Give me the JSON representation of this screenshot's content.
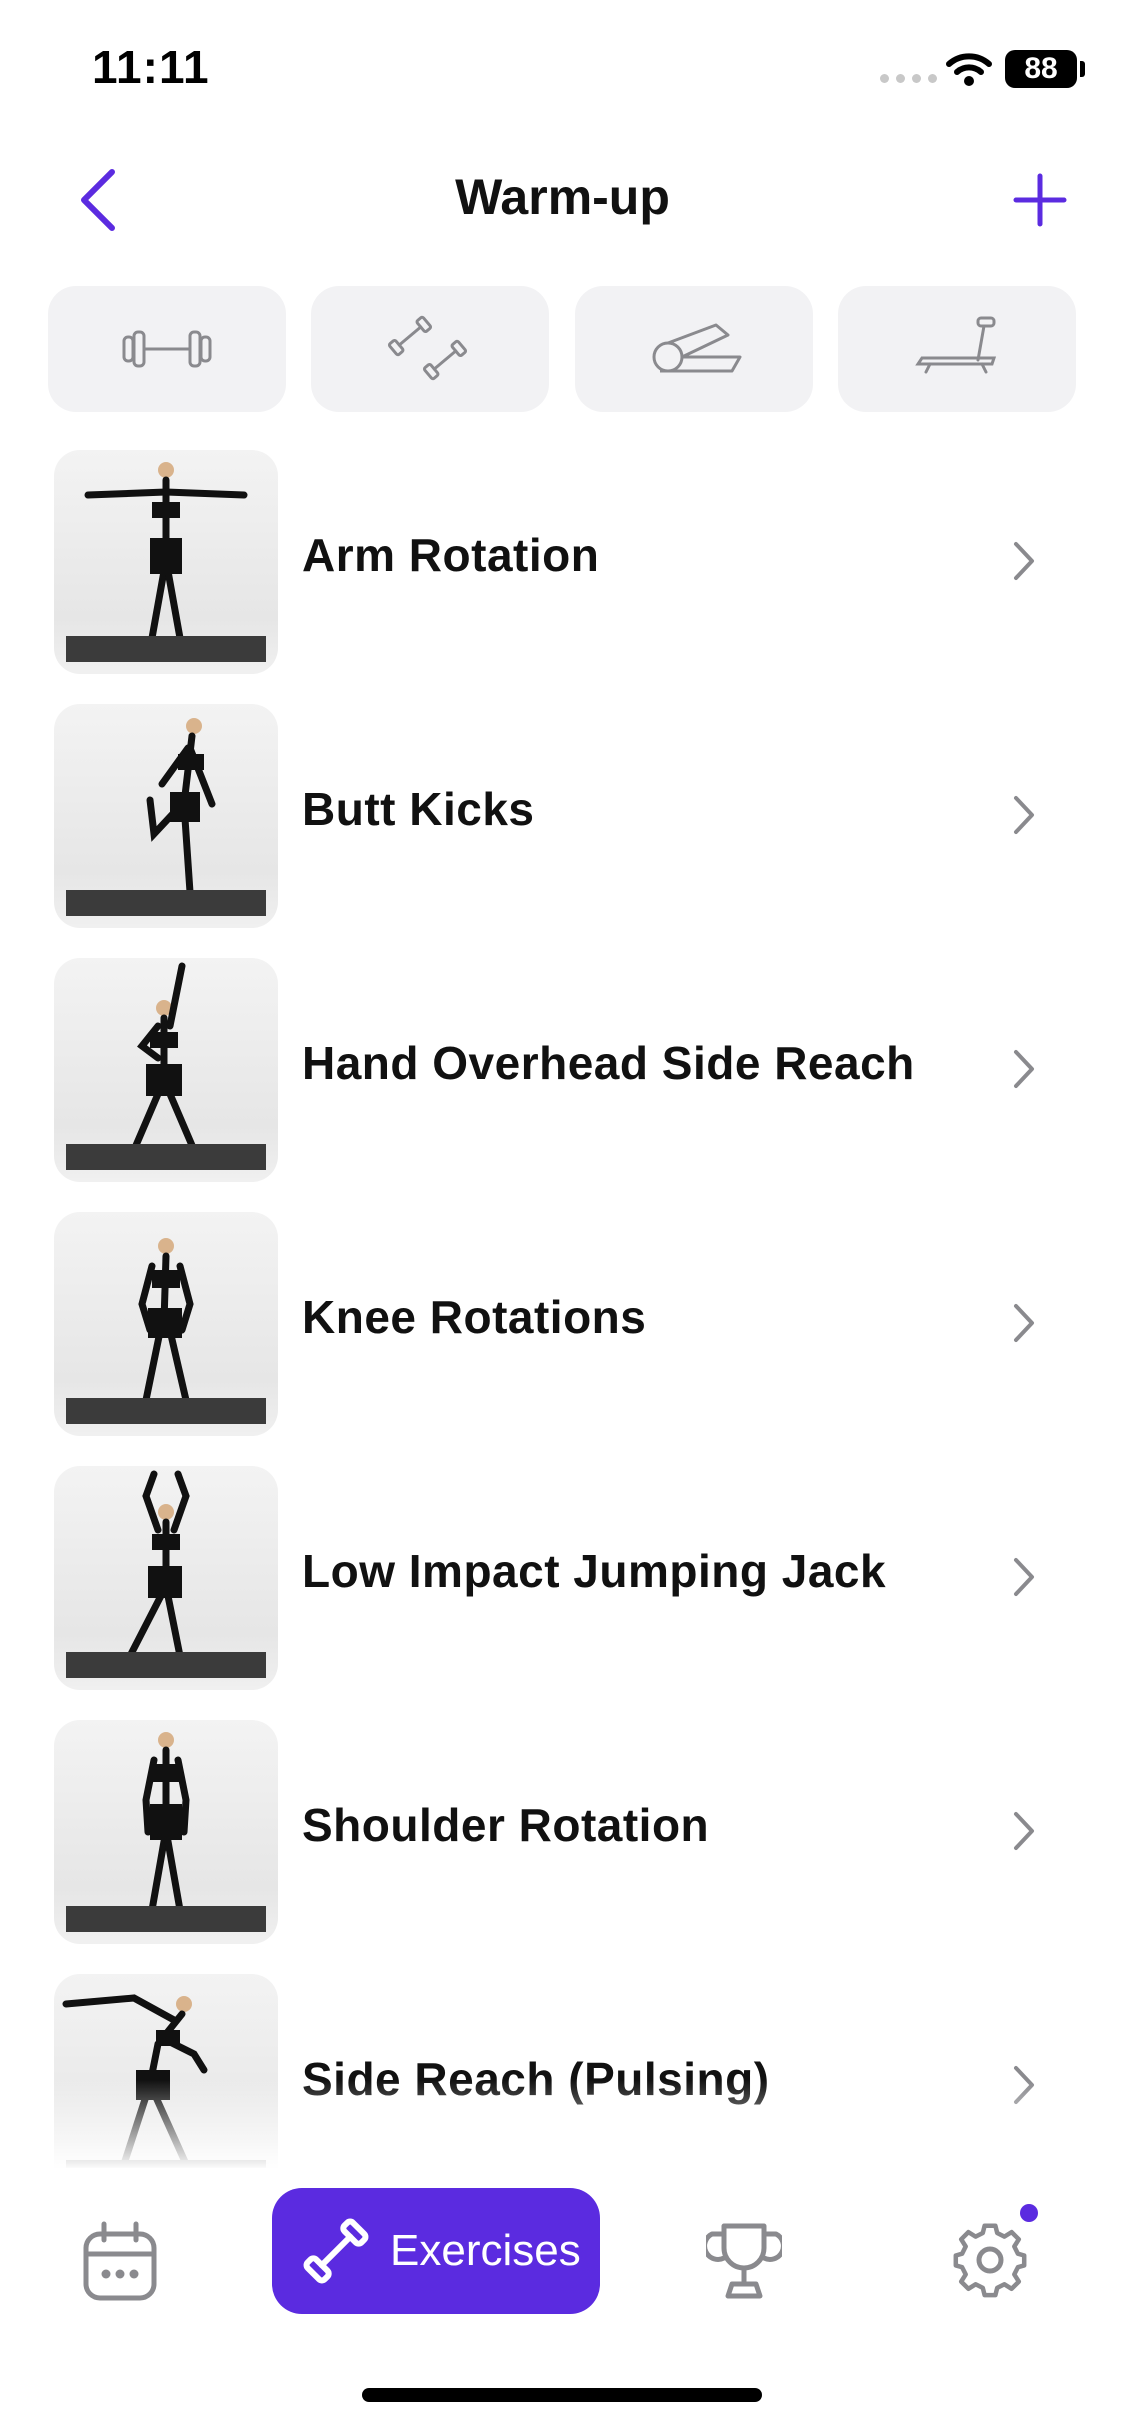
{
  "status_bar": {
    "time": "11:11",
    "battery": "88"
  },
  "nav": {
    "title": "Warm-up",
    "back_icon": "chevron-left-icon",
    "add_icon": "plus-icon"
  },
  "filters": [
    {
      "icon": "barbell-icon"
    },
    {
      "icon": "dumbbells-icon"
    },
    {
      "icon": "yoga-mat-icon"
    },
    {
      "icon": "treadmill-icon"
    }
  ],
  "exercises": [
    {
      "name": "Arm Rotation",
      "pose": "arms-out"
    },
    {
      "name": "Butt Kicks",
      "pose": "leg-back"
    },
    {
      "name": "Hand Overhead Side Reach",
      "pose": "one-arm-up"
    },
    {
      "name": "Knee Rotations",
      "pose": "bent"
    },
    {
      "name": "Low Impact Jumping Jack",
      "pose": "arms-up"
    },
    {
      "name": "Shoulder Rotation",
      "pose": "standing"
    },
    {
      "name": "Side Reach (Pulsing)",
      "pose": "side-bend"
    }
  ],
  "tabbar": {
    "items": [
      {
        "icon": "calendar-icon"
      },
      {
        "icon": "dumbbell-icon",
        "label": "Exercises"
      },
      {
        "icon": "trophy-icon"
      },
      {
        "icon": "gear-icon"
      }
    ],
    "active_index": 1
  },
  "colors": {
    "accent": "#5b2be0",
    "chip_bg": "#f2f2f4",
    "icon_gray": "#8a8a8e"
  }
}
